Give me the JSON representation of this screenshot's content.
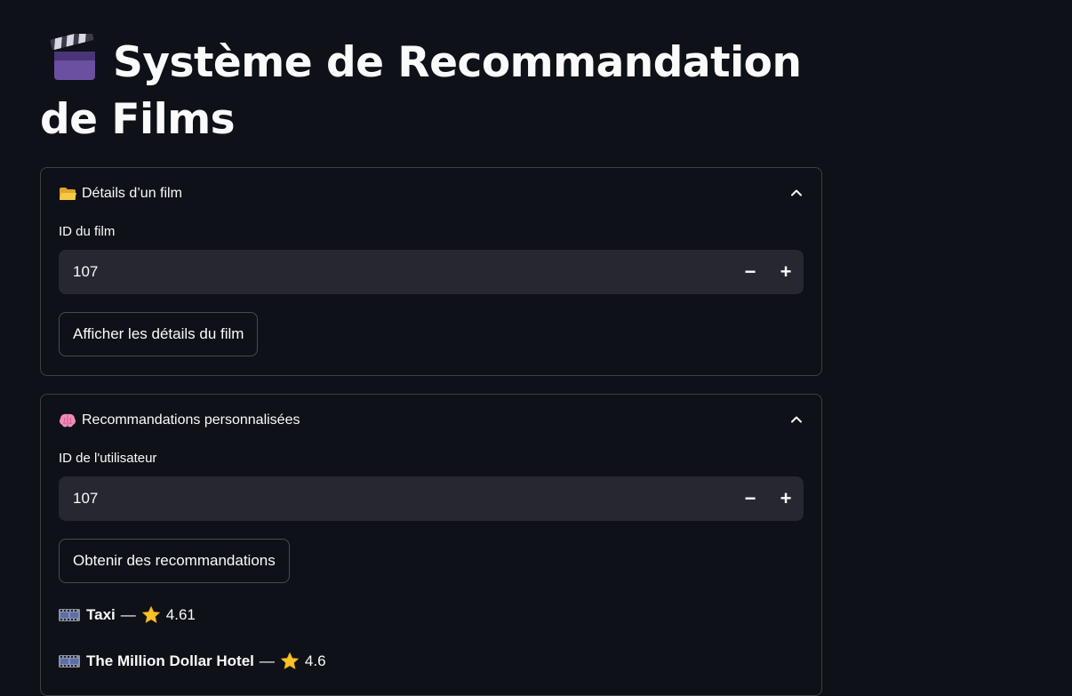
{
  "page": {
    "title": "Système de Recommandation de Films",
    "title_icon": "clapper-board-icon"
  },
  "film_details": {
    "header": "Détails d’un film",
    "header_icon": "folder-icon",
    "input_label": "ID du film",
    "input_value": "107",
    "decrement": "−",
    "increment": "+",
    "button_label": "Afficher les détails du film"
  },
  "recommendations": {
    "header": "Recommandations personnalisées",
    "header_icon": "brain-icon",
    "input_label": "ID de l'utilisateur",
    "input_value": "107",
    "decrement": "−",
    "increment": "+",
    "button_label": "Obtenir des recommandations",
    "separator": "—",
    "items": [
      {
        "title": "Taxi",
        "rating": "4.61"
      },
      {
        "title": "The Million Dollar Hotel",
        "rating": "4.6"
      }
    ]
  },
  "colors": {
    "background": "#0e1117",
    "input_bg": "#262730",
    "text": "#fafafa",
    "star": "#f7c325"
  }
}
